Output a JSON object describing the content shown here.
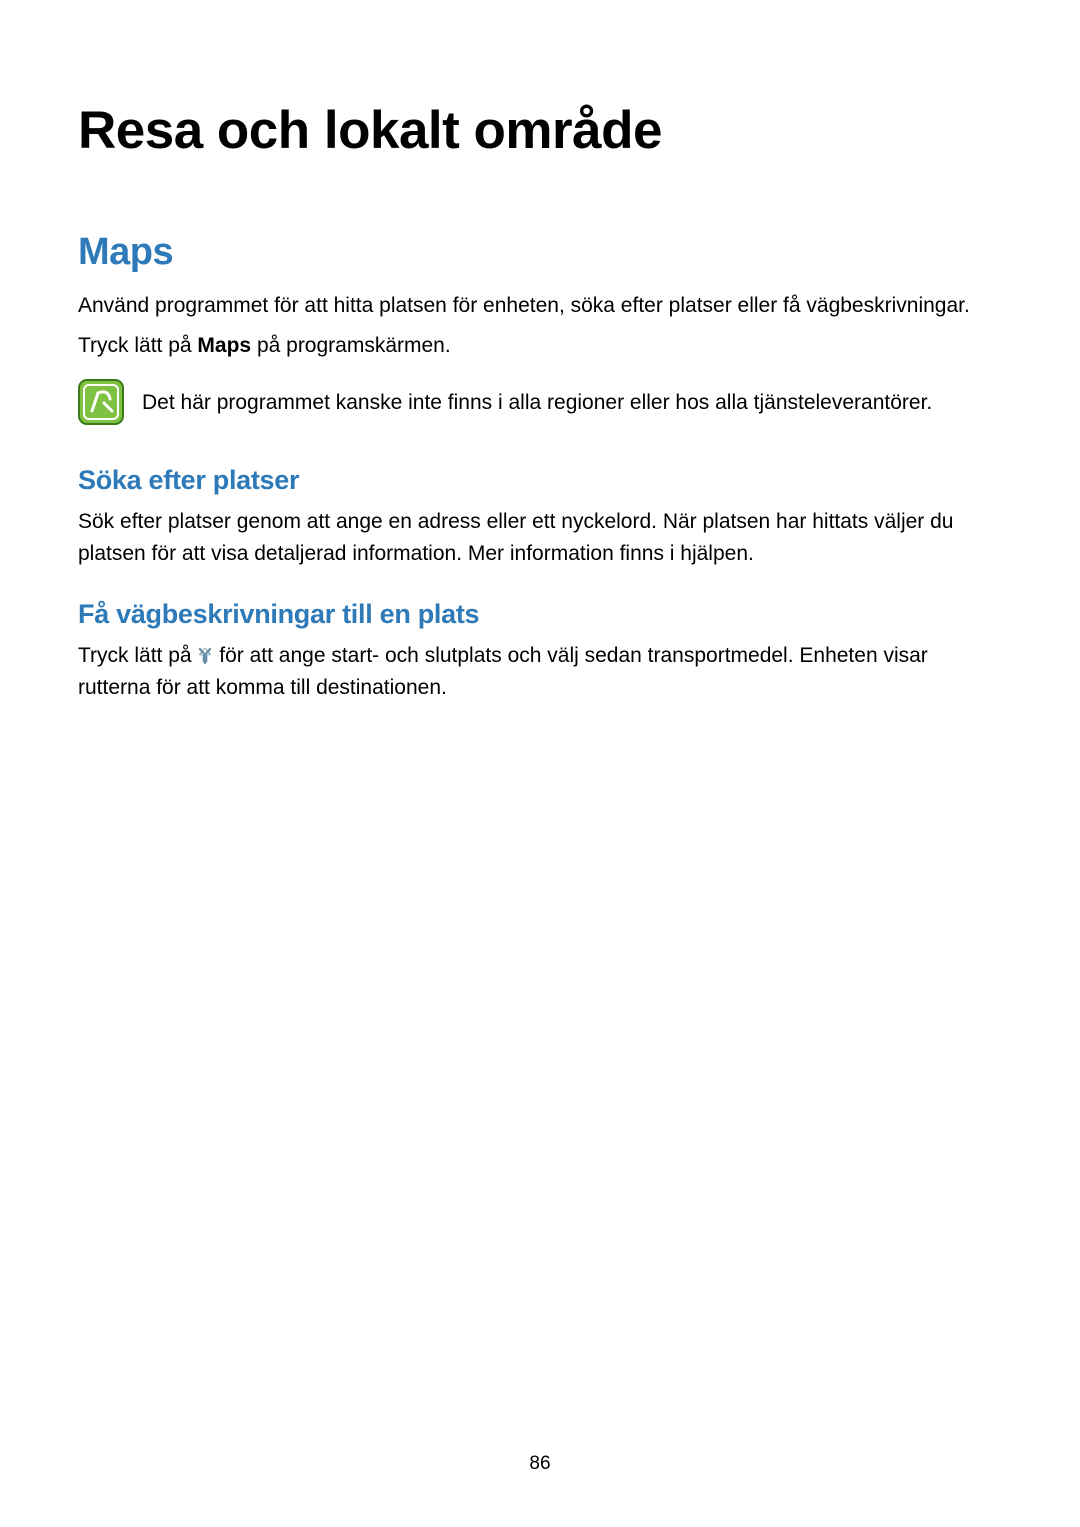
{
  "chapter_title": "Resa och lokalt område",
  "section": {
    "title": "Maps",
    "intro": "Använd programmet för att hitta platsen för enheten, söka efter platser eller få vägbeskrivningar.",
    "tap_prefix": "Tryck lätt på ",
    "tap_bold": "Maps",
    "tap_suffix": " på programskärmen.",
    "note": "Det här programmet kanske inte finns i alla regioner eller hos alla tjänsteleverantörer."
  },
  "sub1": {
    "title": "Söka efter platser",
    "text": "Sök efter platser genom att ange en adress eller ett nyckelord. När platsen har hittats väljer du platsen för att visa detaljerad information. Mer information finns i hjälpen."
  },
  "sub2": {
    "title": "Få vägbeskrivningar till en plats",
    "text_prefix": "Tryck lätt på ",
    "text_suffix": " för att ange start- och slutplats och välj sedan transportmedel. Enheten visar rutterna för att komma till destinationen."
  },
  "page_number": "86"
}
